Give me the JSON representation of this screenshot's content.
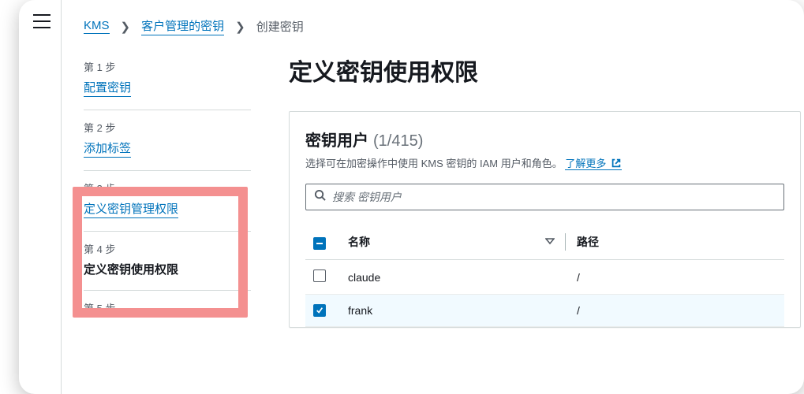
{
  "breadcrumbs": {
    "root": "KMS",
    "mid": "客户管理的密钥",
    "current": "创建密钥"
  },
  "wizard": {
    "steps": [
      {
        "num": "第 1 步",
        "label": "配置密钥",
        "link": true,
        "current": false
      },
      {
        "num": "第 2 步",
        "label": "添加标签",
        "link": true,
        "current": false
      },
      {
        "num": "第 3 步",
        "label": "定义密钥管理权限",
        "link": true,
        "current": false
      },
      {
        "num": "第 4 步",
        "label": "定义密钥使用权限",
        "link": false,
        "current": true
      },
      {
        "num": "第 5 步",
        "label": "",
        "link": false,
        "current": false
      }
    ]
  },
  "main": {
    "title": "定义密钥使用权限",
    "panel_title": "密钥用户",
    "panel_count": "(1/415)",
    "panel_desc_prefix": "选择可在加密操作中使用 KMS 密钥的 IAM 用户和角色。",
    "learn_more": "了解更多",
    "search_placeholder": "搜索 密钥用户",
    "columns": {
      "name": "名称",
      "path": "路径"
    },
    "rows": [
      {
        "name": "claude",
        "path": "/",
        "checked": false
      },
      {
        "name": "frank",
        "path": "/",
        "checked": true
      }
    ]
  }
}
